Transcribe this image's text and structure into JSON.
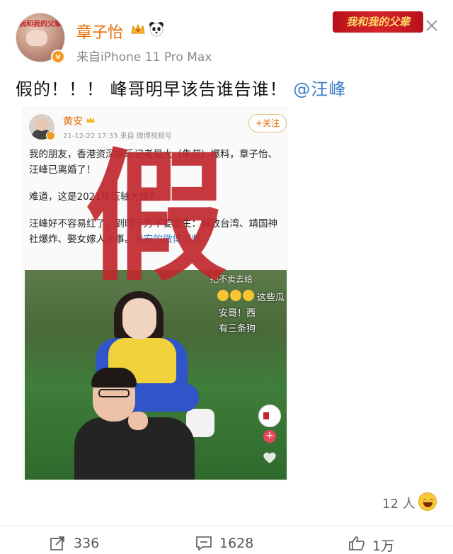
{
  "post": {
    "author": "章子怡",
    "source": "来自iPhone 11 Pro Max",
    "brand_logo": "我和我的父辈",
    "text_main": "假的！！！ 峰哥明早该告谁告谁！",
    "mention": "@汪峰"
  },
  "embed": {
    "author": "黄安",
    "meta": "21-12-22 17:33  来自 微博视频号",
    "follow_label": "+关注",
    "para1": "我的朋友，香港资深娱乐记者是大（朱叔）爆料，章子怡、汪峰已离婚了！",
    "para2": "难道，这是2021年压轴大戏？",
    "para3_prefix": "汪峰好不容易红了，到时千万不要发生：解放台湾、靖国神社爆炸、娶女嫁人大事。",
    "para3_link": "黄安的微博视频",
    "stamp": "假",
    "video": {
      "caption_top": "把不卖去给",
      "caption_lines": [
        "这些瓜",
        "安哥！西",
        "有三条狗"
      ],
      "plus": "+"
    }
  },
  "likes": {
    "count_label": "12 人"
  },
  "actions": {
    "share": "336",
    "comment": "1628",
    "like": "1万"
  },
  "colors": {
    "username": "#e86b00",
    "mention": "#3d7ec7",
    "stamp": "#c0282e"
  }
}
